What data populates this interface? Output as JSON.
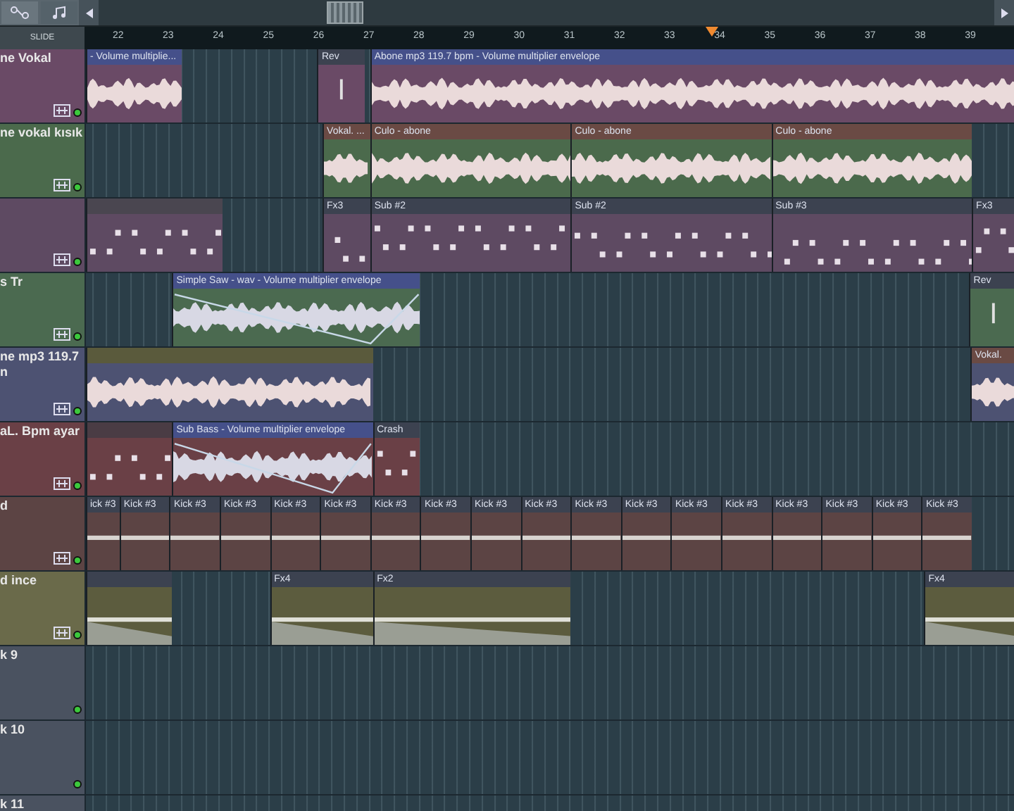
{
  "toolbar": {
    "snap_label": "SLIDE"
  },
  "ruler": {
    "bars": [
      "22",
      "23",
      "24",
      "25",
      "26",
      "27",
      "28",
      "29",
      "30",
      "31",
      "32",
      "33",
      "34",
      "35",
      "36",
      "37",
      "38",
      "39"
    ]
  },
  "tracks": [
    {
      "name": "ne Vokal",
      "color": "#6a4a66",
      "enabled": true,
      "clips": [
        {
          "title": "- Volume multiplie...",
          "kind": "audio",
          "color": "#45508a"
        },
        {
          "title": "Rev",
          "kind": "marker",
          "color": "#3c4250"
        },
        {
          "title": "Abone mp3 119.7 bpm - Volume multiplier envelope",
          "kind": "audio",
          "color": "#45508a"
        }
      ]
    },
    {
      "name": "ne vokal kısık",
      "color": "#4b6a4c",
      "enabled": true,
      "clips": [
        {
          "title": "Vokal. ...",
          "kind": "audio",
          "color": "#6a4a44"
        },
        {
          "title": "Culo - abone",
          "kind": "audio",
          "color": "#6a4a44"
        },
        {
          "title": "Culo - abone",
          "kind": "audio",
          "color": "#6a4a44"
        },
        {
          "title": "Culo - abone",
          "kind": "audio",
          "color": "#6a4a44"
        }
      ]
    },
    {
      "color": "#5e4a62",
      "enabled": true,
      "clips": [
        {
          "kind": "notes",
          "color": "#4a4650"
        },
        {
          "title": "Fx3",
          "kind": "notes",
          "color": "#3c4250"
        },
        {
          "title": "Sub #2",
          "kind": "notes",
          "color": "#3c4250"
        },
        {
          "title": "Sub #2",
          "kind": "notes",
          "color": "#3c4250"
        },
        {
          "title": "Sub #3",
          "kind": "notes",
          "color": "#3c4250"
        },
        {
          "title": "Fx3",
          "kind": "notes",
          "color": "#3c4250"
        }
      ]
    },
    {
      "name": "s Tr",
      "color": "#4b6a50",
      "enabled": true,
      "clips": [
        {
          "title": "Simple Saw - wav - Volume multiplier envelope",
          "kind": "envelope",
          "color": "#45508a"
        },
        {
          "title": "Rev",
          "kind": "marker",
          "color": "#3c4250"
        }
      ]
    },
    {
      "name": "ne mp3 119.7\nn",
      "color": "#4d5272",
      "enabled": true,
      "clips": [
        {
          "kind": "audio",
          "color": "#5a5a3c"
        },
        {
          "title": "Vokal.",
          "kind": "audio",
          "color": "#6a4a44"
        }
      ]
    },
    {
      "name": "aL. Bpm ayar",
      "color": "#6a4046",
      "enabled": true,
      "clips": [
        {
          "kind": "notes",
          "color": "#4a3c44"
        },
        {
          "title": "Sub Bass - Volume multiplier envelope",
          "kind": "envelope",
          "color": "#45508a"
        },
        {
          "title": "Crash",
          "kind": "notes",
          "color": "#3c4250"
        }
      ]
    },
    {
      "name": "d",
      "color": "#5c4444",
      "enabled": true,
      "clips": [
        {
          "title": "ick #3",
          "kind": "kick",
          "color": "#3c4250"
        },
        {
          "title": "Kick #3",
          "kind": "kick",
          "color": "#3c4250"
        },
        {
          "title": "Kick #3",
          "kind": "kick",
          "color": "#3c4250"
        },
        {
          "title": "Kick #3",
          "kind": "kick",
          "color": "#3c4250"
        },
        {
          "title": "Kick #3",
          "kind": "kick",
          "color": "#3c4250"
        },
        {
          "title": "Kick #3",
          "kind": "kick",
          "color": "#3c4250"
        },
        {
          "title": "Kick #3",
          "kind": "kick",
          "color": "#3c4250"
        },
        {
          "title": "Kick #3",
          "kind": "kick",
          "color": "#3c4250"
        },
        {
          "title": "Kick #3",
          "kind": "kick",
          "color": "#3c4250"
        },
        {
          "title": "Kick #3",
          "kind": "kick",
          "color": "#3c4250"
        },
        {
          "title": "Kick #3",
          "kind": "kick",
          "color": "#3c4250"
        },
        {
          "title": "Kick #3",
          "kind": "kick",
          "color": "#3c4250"
        },
        {
          "title": "Kick #3",
          "kind": "kick",
          "color": "#3c4250"
        },
        {
          "title": "Kick #3",
          "kind": "kick",
          "color": "#3c4250"
        },
        {
          "title": "Kick #3",
          "kind": "kick",
          "color": "#3c4250"
        },
        {
          "title": "Kick #3",
          "kind": "kick",
          "color": "#3c4250"
        },
        {
          "title": "Kick #3",
          "kind": "kick",
          "color": "#3c4250"
        },
        {
          "title": "Kick #3",
          "kind": "kick",
          "color": "#3c4250"
        }
      ]
    },
    {
      "name": "d ince",
      "color": "#6a6a4a",
      "enabled": true,
      "clips": [
        {
          "kind": "automation",
          "color": "#3c4250"
        },
        {
          "title": "Fx4",
          "kind": "automation",
          "color": "#3c4250"
        },
        {
          "title": "Fx2",
          "kind": "automation",
          "color": "#3c4250"
        },
        {
          "title": "Fx4",
          "kind": "automation",
          "color": "#3c4250"
        }
      ]
    },
    {
      "name": "k 9",
      "color": "#4a5260",
      "enabled": true
    },
    {
      "name": "k 10",
      "color": "#4a5260",
      "enabled": true
    },
    {
      "name": "k 11",
      "color": "#4a5260"
    }
  ]
}
